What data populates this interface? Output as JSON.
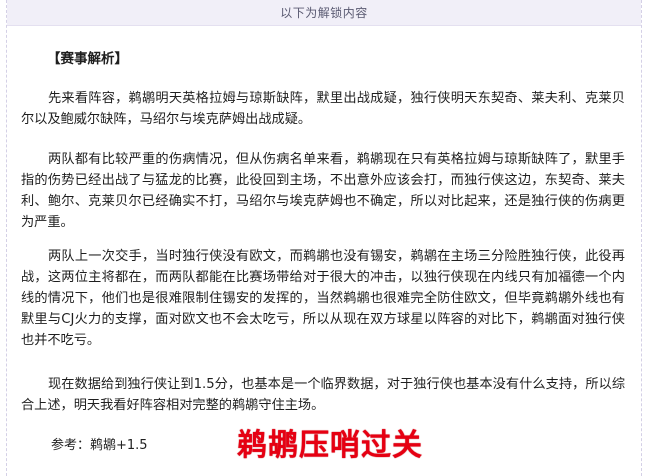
{
  "banner": {
    "text": "以下为解锁内容"
  },
  "article": {
    "heading": "【赛事解析】",
    "paragraphs": [
      "先来看阵容，鹈鹕明天英格拉姆与琼斯缺阵，默里出战成疑，独行侠明天东契奇、莱夫利、克莱贝尔以及鲍威尔缺阵，马绍尔与埃克萨姆出战成疑。",
      "两队都有比较严重的伤病情况，但从伤病名单来看，鹈鹕现在只有英格拉姆与琼斯缺阵了，默里手指的伤势已经出战了与猛龙的比赛，此役回到主场，不出意外应该会打，而独行侠这边，东契奇、莱夫利、鲍尔、克莱贝尔已经确实不打，马绍尔与埃克萨姆也不确定，所以对比起来，还是独行侠的伤病更为严重。",
      "两队上一次交手，当时独行侠没有欧文，而鹈鹕也没有锡安，鹈鹕在主场三分险胜独行侠，此役再战，这两位主将都在，而两队都能在比赛场带给对于很大的冲击，以独行侠现在内线只有加福德一个内线的情况下，他们也是很难限制住锡安的发挥的，当然鹈鹕也很难完全防住欧文，但毕竟鹈鹕外线也有默里与CJ火力的支撑，面对欧文也不会太吃亏，所以从现在双方球星以阵容的对比下，鹈鹕面对独行侠也并不吃亏。",
      "现在数据给到独行侠让到1.5分，也基本是一个临界数据，对于独行侠也基本没有什么支持，所以综合上述，明天我看好阵容相对完整的鹈鹕守住主场。"
    ],
    "reference": "参考：鹈鹕+1.5",
    "stamp": "鹈鹕压哨过关"
  },
  "colors": {
    "stamp": "#e60012",
    "banner_bg": "#f1eff8"
  }
}
